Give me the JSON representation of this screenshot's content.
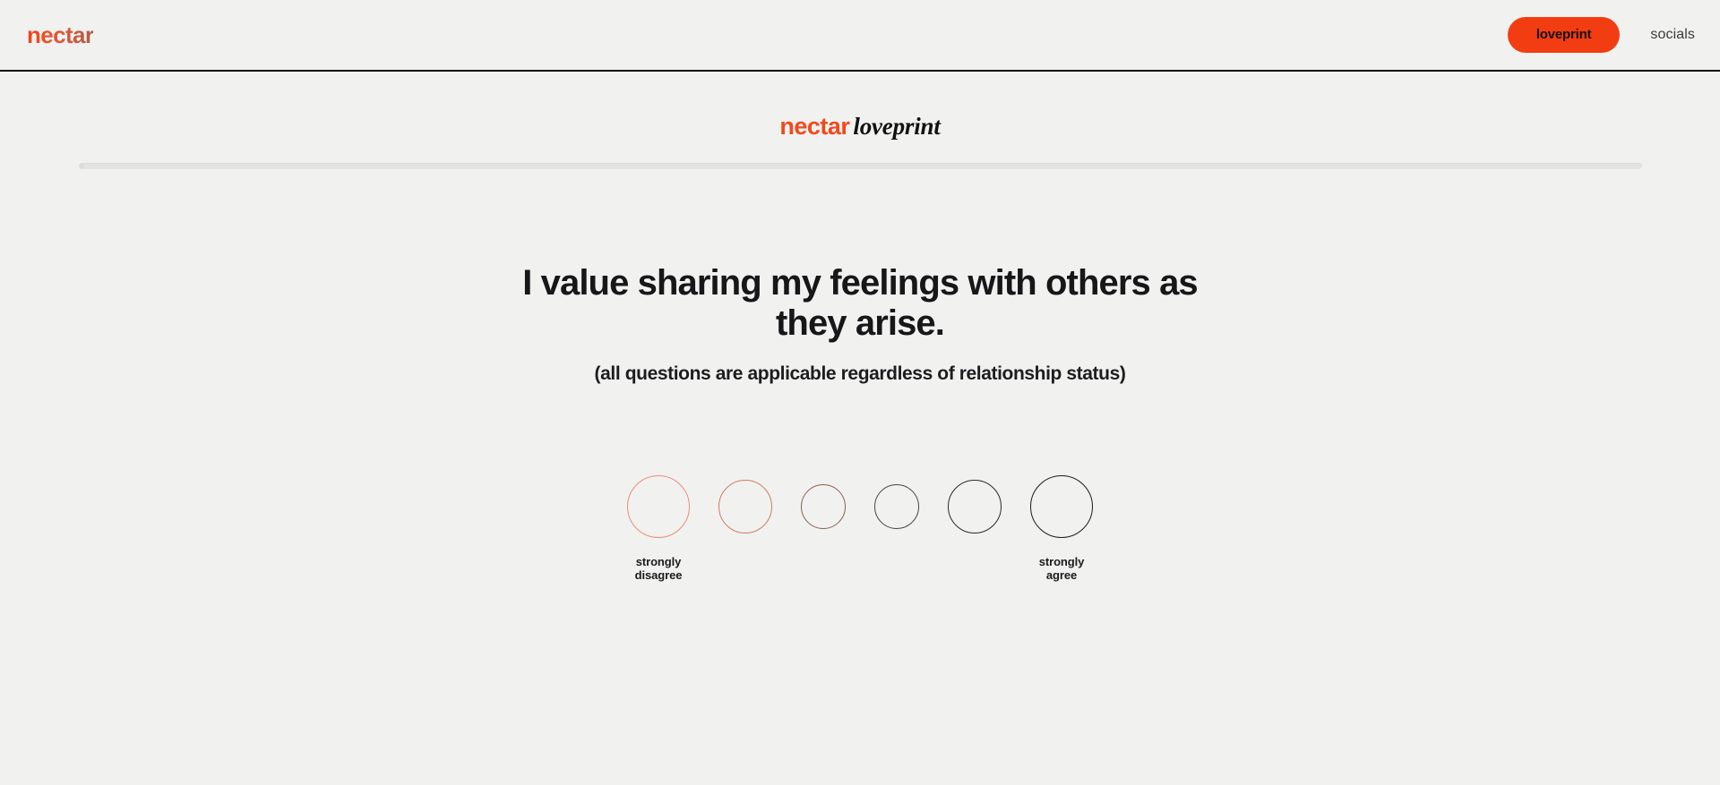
{
  "header": {
    "logo_text": "nectar",
    "cta_label": "loveprint",
    "socials_label": "socials"
  },
  "survey": {
    "brand_primary": "nectar",
    "brand_secondary": "loveprint",
    "progress_percent": 0,
    "question": "I value sharing my feelings with others as they arise.",
    "subtext": "(all questions are applicable regardless of relationship status)",
    "scale": {
      "left_label": "strongly\ndisagree",
      "right_label": "strongly\nagree",
      "options": [
        {
          "index": 1,
          "size": 70,
          "color": "#e98f72",
          "border_width": 1.3,
          "gap_after": 32
        },
        {
          "index": 2,
          "size": 60,
          "color": "#cf7e63",
          "border_width": 1.2,
          "gap_after": 32
        },
        {
          "index": 3,
          "size": 50,
          "color": "#8d5f4e",
          "border_width": 1.1,
          "gap_after": 32
        },
        {
          "index": 4,
          "size": 50,
          "color": "#4d4246",
          "border_width": 1.1,
          "gap_after": 32
        },
        {
          "index": 5,
          "size": 60,
          "color": "#2b2b30",
          "border_width": 1.2,
          "gap_after": 32
        },
        {
          "index": 6,
          "size": 70,
          "color": "#1b1b20",
          "border_width": 1.3,
          "gap_after": 0
        }
      ]
    }
  },
  "colors": {
    "background": "#f1f1f0",
    "accent": "#f23d12",
    "logo": "#ef4a1e",
    "text": "#17171a",
    "track": "#e4e4e2"
  }
}
